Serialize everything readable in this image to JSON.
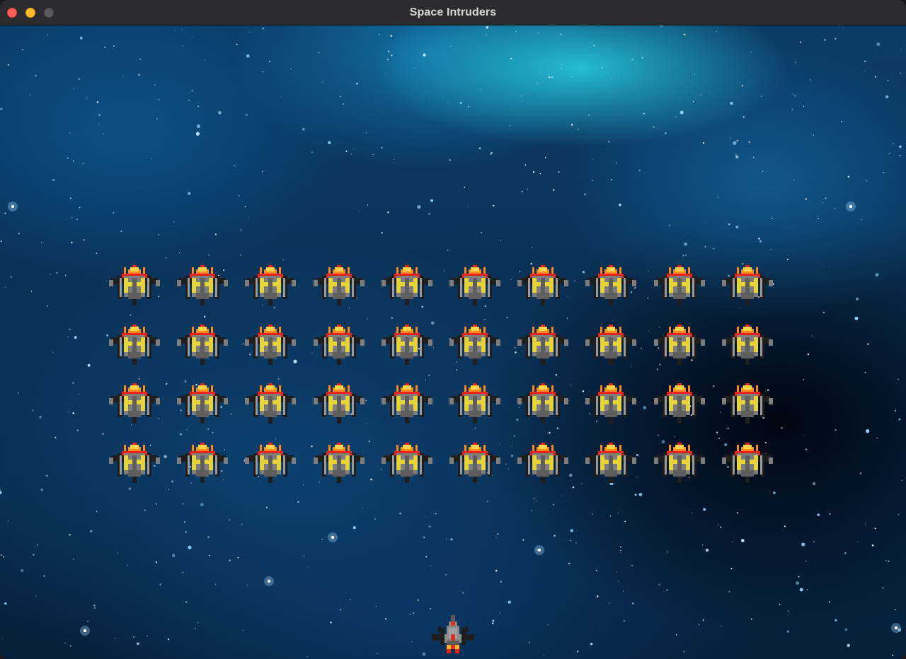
{
  "window": {
    "title": "Space Intruders"
  },
  "game": {
    "invaders": {
      "rows": 4,
      "columns": 10,
      "sprite": "alien-fighter-icon"
    },
    "player": {
      "sprite": "player-ship-icon"
    }
  },
  "colors": {
    "alien_body": "#7d7d7d",
    "alien_trim": "#e6d43a",
    "alien_flame": "#ff8a1c",
    "alien_hot": "#e8231a",
    "player_body": "#8a8a8a",
    "player_accent": "#d9342b"
  }
}
